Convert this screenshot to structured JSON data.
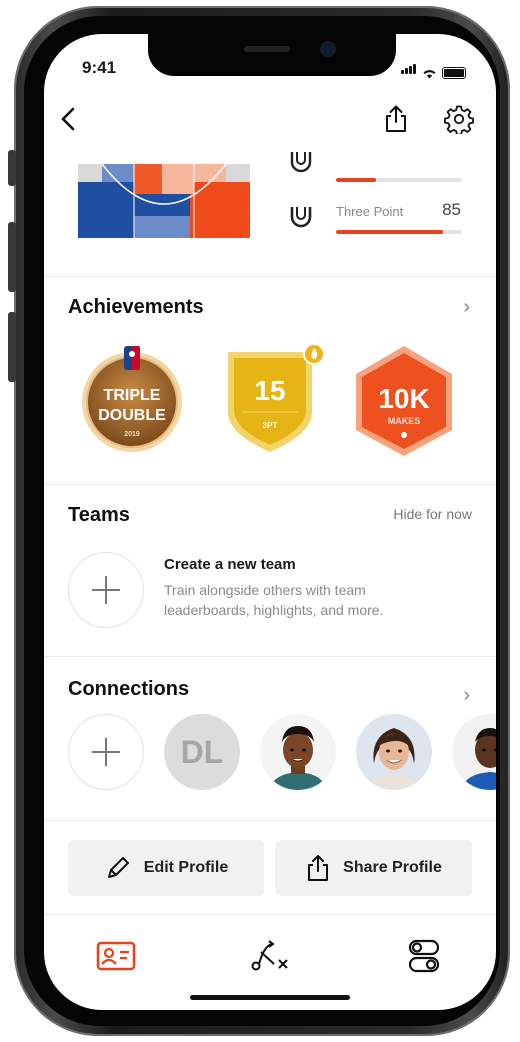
{
  "status_bar": {
    "time": "9:41"
  },
  "shot_stats": [
    {
      "label": "",
      "value": "",
      "fill": 0.32
    },
    {
      "label": "Three Point",
      "value": "85",
      "fill": 0.85
    }
  ],
  "achievements": {
    "title": "Achievements",
    "badges": [
      {
        "name": "triple-double",
        "line1": "TRIPLE",
        "line2": "DOUBLE",
        "year": "2019"
      },
      {
        "name": "15-3pt",
        "number": "15",
        "sub": "3PT"
      },
      {
        "name": "10k-makes",
        "number": "10K",
        "sub": "MAKES"
      }
    ]
  },
  "teams": {
    "title": "Teams",
    "hide_label": "Hide for now",
    "create_title": "Create a new team",
    "create_desc": "Train alongside others with team leaderboards, highlights, and more."
  },
  "connections": {
    "title": "Connections",
    "initials": "DL"
  },
  "profile_actions": {
    "edit_label": "Edit Profile",
    "share_label": "Share Profile"
  },
  "colors": {
    "accent": "#e8421c",
    "court_blue": "#1f4fa0",
    "gold": "#f2c12e"
  }
}
